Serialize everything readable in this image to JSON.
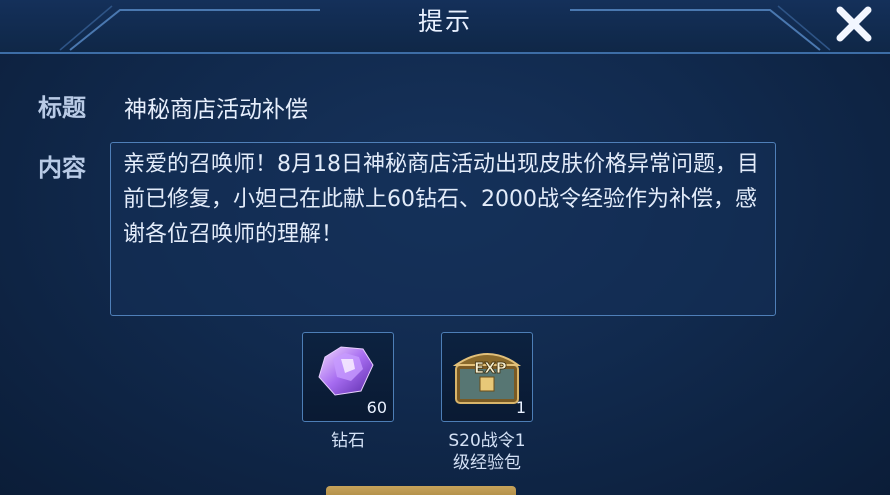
{
  "header": {
    "title": "提示"
  },
  "fields": {
    "title_label": "标题",
    "title_value": "神秘商店活动补偿",
    "content_label": "内容",
    "content_text": "亲爱的召唤师！8月18日神秘商店活动出现皮肤价格异常问题，目前已修复，小妲己在此献上60钻石、2000战令经验作为补偿，感谢各位召唤师的理解！"
  },
  "rewards": [
    {
      "name": "钻石",
      "count": "60",
      "icon": "diamond-icon"
    },
    {
      "name_line1": "S20战令1",
      "name_line2": "级经验包",
      "count": "1",
      "icon": "exp-chest-icon"
    }
  ],
  "colors": {
    "background": "#112a4e",
    "border_accent": "#4f7fb8",
    "text_primary": "#e6eefc",
    "label_text": "#b9cbe6",
    "button_gold": "#c7a35a"
  }
}
